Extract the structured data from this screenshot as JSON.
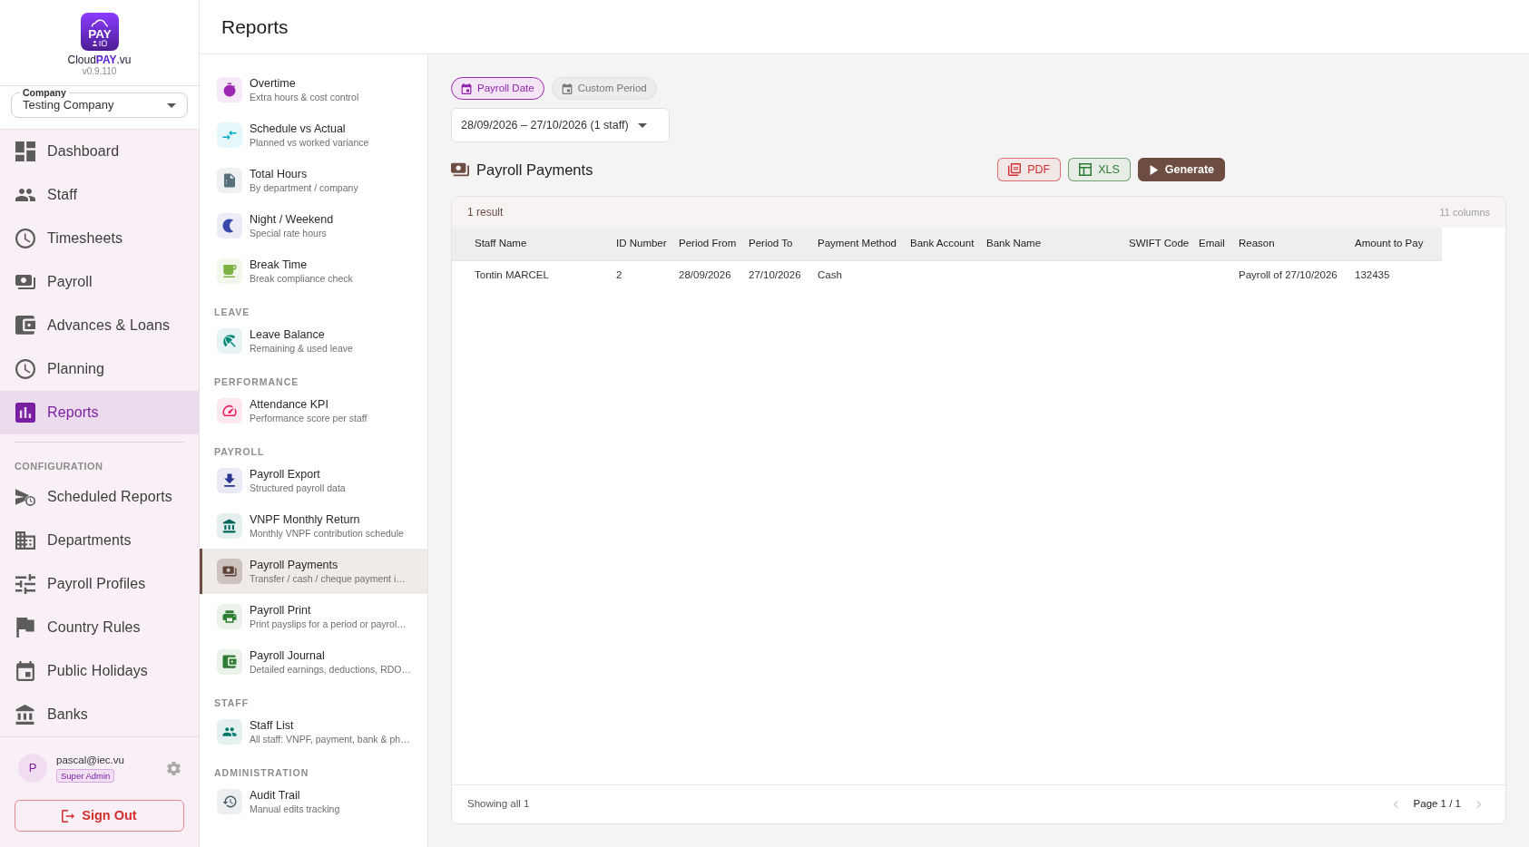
{
  "sidebar": {
    "logo": {
      "text": "PAY"
    },
    "brand": "Cloud**PAY**.vu",
    "version": "v0.9.110",
    "company": {
      "label": "Company",
      "value": "Testing Company"
    },
    "nav": [
      {
        "label": "Dashboard",
        "selected": false
      },
      {
        "label": "Staff",
        "selected": false
      },
      {
        "label": "Timesheets",
        "selected": false
      },
      {
        "label": "Payroll",
        "selected": false
      },
      {
        "label": "Advances & Loans",
        "selected": false
      },
      {
        "label": "Planning",
        "selected": false
      },
      {
        "label": "Reports",
        "selected": true
      }
    ],
    "sections": [
      {
        "title": "CONFIGURATION",
        "items": [
          {
            "label": "Scheduled Reports",
            "selected": false
          },
          {
            "label": "Departments",
            "selected": false
          },
          {
            "label": "Payroll Profiles",
            "selected": false
          },
          {
            "label": "Country Rules",
            "selected": false
          },
          {
            "label": "Public Holidays",
            "selected": false
          },
          {
            "label": "Banks",
            "selected": false
          }
        ]
      }
    ],
    "user": {
      "avatar": "P",
      "email": "pascal@iec.vu",
      "role": "Super Admin"
    },
    "sign_out": "Sign Out"
  },
  "header": {
    "title": "Reports"
  },
  "report_list": {
    "sections": [
      {
        "items": [
          {
            "title": "Overtime",
            "subtitle": "Extra hours & cost control",
            "color": "#9c27b0",
            "selected": false
          },
          {
            "title": "Schedule vs Actual",
            "subtitle": "Planned vs worked variance",
            "color": "#00acc1",
            "selected": false
          },
          {
            "title": "Total Hours",
            "subtitle": "By department / company",
            "color": "#546e7a",
            "selected": false
          },
          {
            "title": "Night / Weekend",
            "subtitle": "Special rate hours",
            "color": "#3949ab",
            "selected": false
          },
          {
            "title": "Break Time",
            "subtitle": "Break compliance check",
            "color": "#7cb342",
            "selected": false
          }
        ]
      },
      {
        "title": "LEAVE",
        "items": [
          {
            "title": "Leave Balance",
            "subtitle": "Remaining & used leave",
            "color": "#00897b",
            "selected": false
          }
        ]
      },
      {
        "title": "PERFORMANCE",
        "items": [
          {
            "title": "Attendance KPI",
            "subtitle": "Performance score per staff",
            "color": "#e91e63",
            "selected": false
          }
        ]
      },
      {
        "title": "PAYROLL",
        "items": [
          {
            "title": "Payroll Export",
            "subtitle": "Structured payroll data",
            "color": "#283593",
            "selected": false
          },
          {
            "title": "VNPF Monthly Return",
            "subtitle": "Monthly VNPF contribution schedule",
            "color": "#00695c",
            "selected": false
          },
          {
            "title": "Payroll Payments",
            "subtitle": "Transfer / cash / cheque payment i…",
            "color": "#5d4037",
            "selected": true
          },
          {
            "title": "Payroll Print",
            "subtitle": "Print payslips for a period or payrol…",
            "color": "#2e7d32",
            "selected": false
          },
          {
            "title": "Payroll Journal",
            "subtitle": "Detailed earnings, deductions, RDO…",
            "color": "#2e7d32",
            "selected": false
          }
        ]
      },
      {
        "title": "STAFF",
        "items": [
          {
            "title": "Staff List",
            "subtitle": "All staff: VNPF, payment, bank & ph…",
            "color": "#00796b",
            "selected": false
          }
        ]
      },
      {
        "title": "ADMINISTRATION",
        "items": [
          {
            "title": "Audit Trail",
            "subtitle": "Manual edits tracking",
            "color": "#455a64",
            "selected": false
          }
        ]
      }
    ]
  },
  "report": {
    "period_modes": [
      {
        "label": "Payroll Date",
        "selected": true
      },
      {
        "label": "Custom Period",
        "selected": false
      }
    ],
    "period": {
      "value": "28/09/2026 – 27/10/2026 (1 staff)"
    },
    "title": "Payroll Payments",
    "actions": [
      {
        "label": "PDF",
        "kind": "outline",
        "color": "#d32f2f"
      },
      {
        "label": "XLS",
        "kind": "outline",
        "color": "#2e7d32"
      },
      {
        "label": "Generate",
        "kind": "filled",
        "color": "#6d4c41"
      }
    ],
    "table": {
      "summary": "1 result",
      "column_count": "11 columns",
      "columns": [
        "Staff Name",
        "ID Number",
        "Period From",
        "Period To",
        "Payment Method",
        "Bank Account",
        "Bank Name",
        "SWIFT Code",
        "Email",
        "Reason",
        "Amount to Pay"
      ],
      "rows": [
        {
          "cells": [
            "Tontin MARCEL",
            "2",
            "28/09/2026",
            "27/10/2026",
            "Cash",
            null,
            null,
            null,
            null,
            "Payroll of 27/10/2026",
            "132435"
          ]
        }
      ],
      "footer": "Showing all 1",
      "pager": {
        "label": "Page 1 / 1",
        "previous_disabled": true,
        "next_disabled": true
      }
    }
  }
}
